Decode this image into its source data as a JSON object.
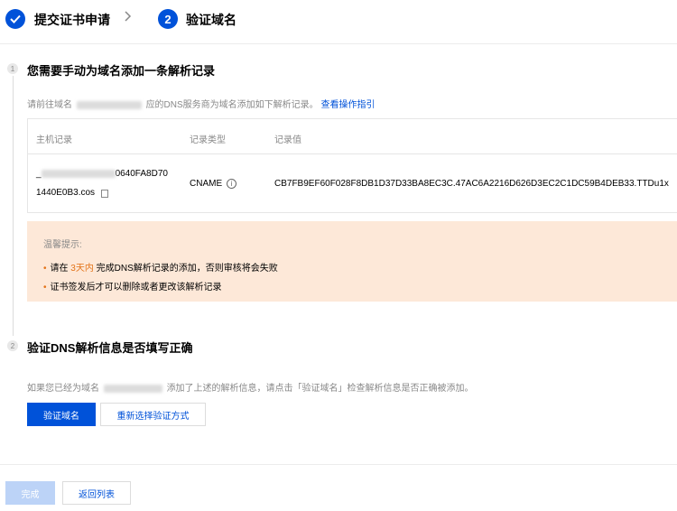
{
  "steps": {
    "step1_label": "提交证书申请",
    "step2_number": "2",
    "step2_label": "验证域名"
  },
  "section1": {
    "number": "1",
    "title": "您需要手动为域名添加一条解析记录",
    "desc_prefix": "请前往域名",
    "desc_suffix": "应的DNS服务商为域名添加如下解析记录。",
    "guide_link": "查看操作指引"
  },
  "table": {
    "headers": [
      "主机记录",
      "记录类型",
      "记录值"
    ],
    "row": {
      "host_prefix": "_",
      "host_line1_suffix": "0640FA8D70",
      "host_line2": "1440E0B3.cos",
      "type": "CNAME",
      "value": "CB7FB9EF60F028F8DB1D37D33BA8EC3C.47AC6A2216D626D3EC2C1DC59B4DEB33.TTDu1x"
    }
  },
  "tip": {
    "title": "温馨提示:",
    "item1_pre": "请在",
    "item1_highlight": "3天内",
    "item1_post": "完成DNS解析记录的添加，否则审核将会失败",
    "item2": "证书签发后才可以删除或者更改该解析记录"
  },
  "section2": {
    "number": "2",
    "title": "验证DNS解析信息是否填写正确",
    "desc_prefix": "如果您已经为域名",
    "desc_suffix": "添加了上述的解析信息，请点击「验证域名」检查解析信息是否正确被添加。"
  },
  "buttons": {
    "verify": "验证域名",
    "reselect": "重新选择验证方式",
    "done": "完成",
    "back": "返回列表"
  },
  "colors": {
    "primary": "#0052d9",
    "warning": "#e37318",
    "tip_bg": "#fde8d8"
  }
}
